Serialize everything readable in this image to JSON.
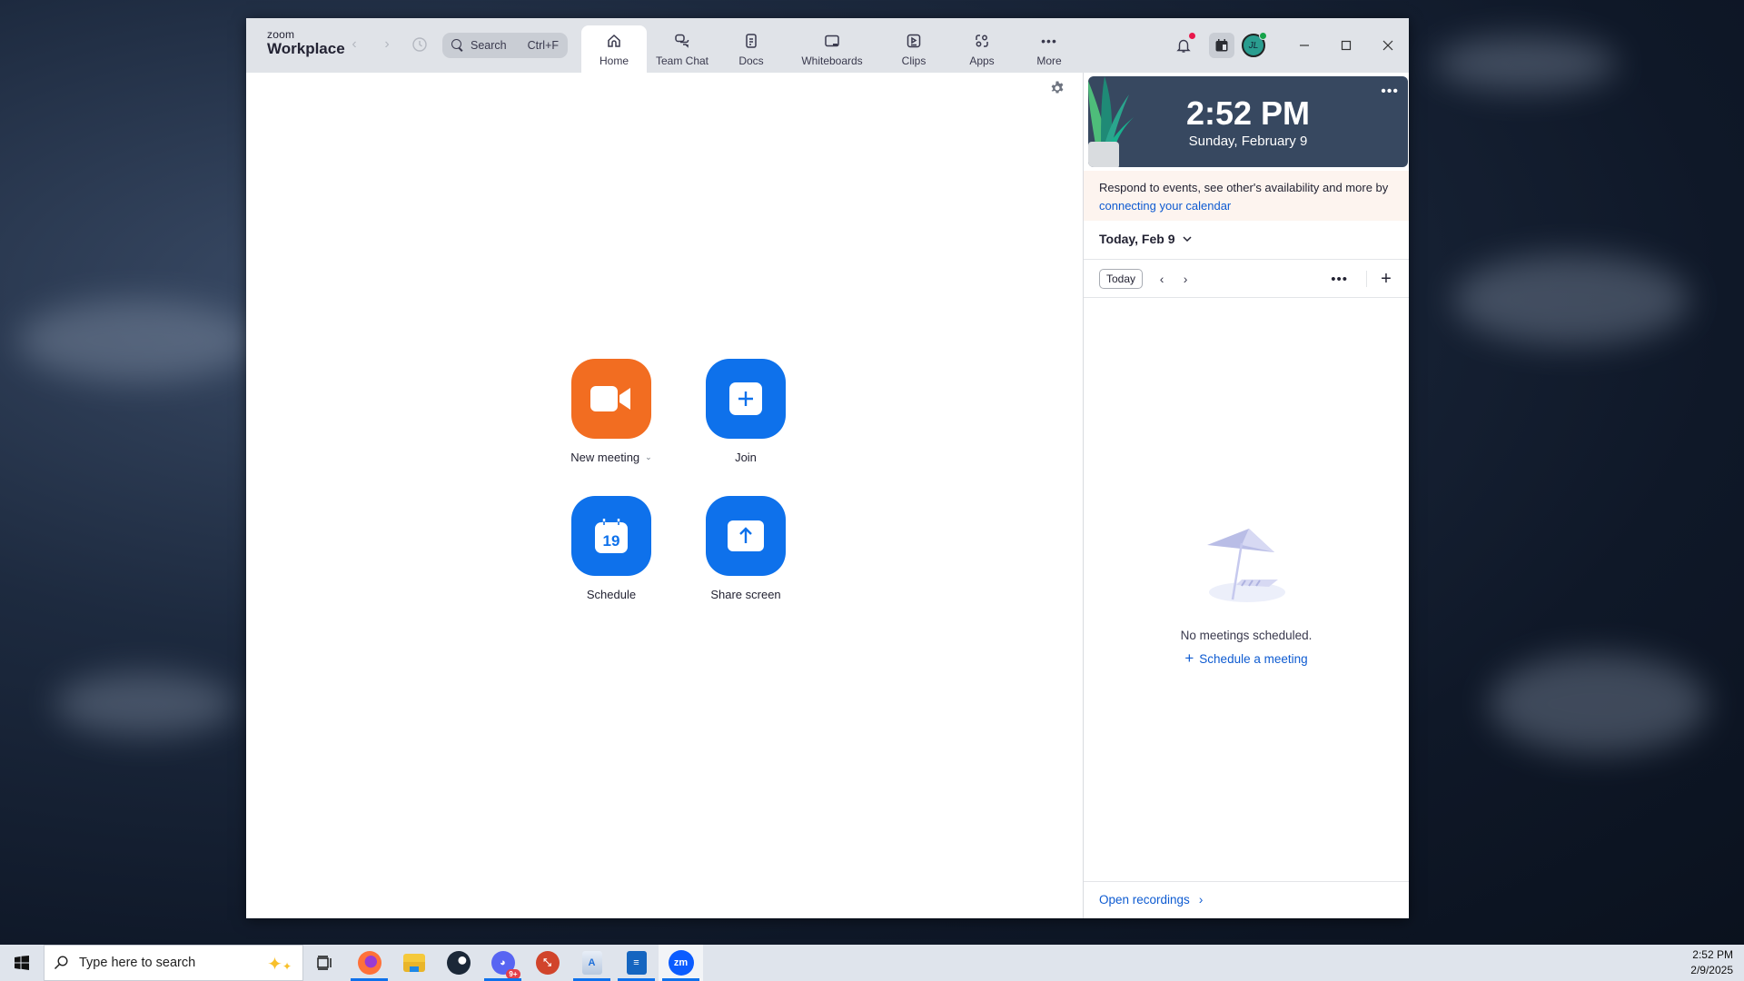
{
  "window": {
    "brand_small": "zoom",
    "brand_big": "Workplace",
    "search": {
      "label": "Search",
      "shortcut": "Ctrl+F"
    },
    "tabs": [
      {
        "label": "Home",
        "icon": "home-icon",
        "active": true
      },
      {
        "label": "Team Chat",
        "icon": "chat-icon",
        "active": false
      },
      {
        "label": "Docs",
        "icon": "docs-icon",
        "active": false
      },
      {
        "label": "Whiteboards",
        "icon": "whiteboard-icon",
        "active": false
      },
      {
        "label": "Clips",
        "icon": "clips-icon",
        "active": false
      },
      {
        "label": "Apps",
        "icon": "apps-icon",
        "active": false
      },
      {
        "label": "More",
        "icon": "more-icon",
        "active": false
      }
    ],
    "avatar_initials": "JL",
    "colors": {
      "accent_blue": "#0e71eb",
      "accent_orange": "#f26d21",
      "notification_red": "#e8174b",
      "online_green": "#16a34a"
    }
  },
  "home": {
    "actions": [
      {
        "label": "New meeting",
        "icon": "video-camera-icon",
        "has_dropdown": true
      },
      {
        "label": "Join",
        "icon": "plus-icon",
        "has_dropdown": false
      },
      {
        "label": "Schedule",
        "icon": "calendar-icon",
        "calendar_day": "19",
        "has_dropdown": false
      },
      {
        "label": "Share screen",
        "icon": "share-up-arrow-icon",
        "has_dropdown": false
      }
    ]
  },
  "side": {
    "clock_time": "2:52 PM",
    "clock_date": "Sunday, February 9",
    "promo_text": "Respond to events, see other's availability and more by ",
    "promo_link": "connecting your calendar",
    "day_picker": "Today, Feb 9",
    "today_button": "Today",
    "empty_message": "No meetings scheduled.",
    "schedule_link": "Schedule a meeting",
    "open_recordings": "Open recordings"
  },
  "taskbar": {
    "search_placeholder": "Type here to search",
    "apps": [
      {
        "name": "Firefox",
        "running": true
      },
      {
        "name": "File Explorer",
        "running": false
      },
      {
        "name": "Steam",
        "running": false
      },
      {
        "name": "Discord",
        "running": true,
        "badge": "9+"
      },
      {
        "name": "Remote Desktop",
        "running": false
      },
      {
        "name": "WordPad",
        "running": true
      },
      {
        "name": "LibreOffice Writer",
        "running": true
      },
      {
        "name": "Zoom",
        "running": true,
        "focused": true
      }
    ],
    "time": "2:52 PM",
    "date": "2/9/2025"
  }
}
